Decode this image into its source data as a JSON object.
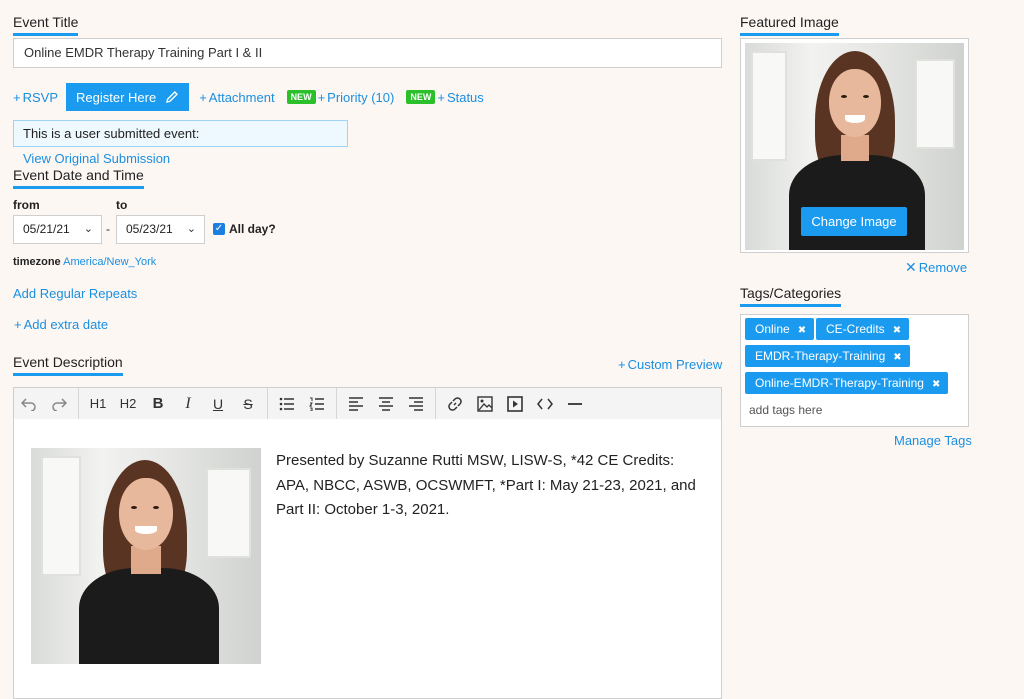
{
  "event_title": {
    "label": "Event Title",
    "value": "Online EMDR Therapy Training Part I & II"
  },
  "actions": {
    "rsvp": "RSVP",
    "register": "Register Here",
    "attachment": "Attachment",
    "new_badge": "NEW",
    "priority": "Priority (10)",
    "status": "Status"
  },
  "notice": {
    "text": "This is a user submitted event:",
    "link": "View Original Submission"
  },
  "date_time": {
    "label": "Event Date and Time",
    "from_label": "from",
    "to_label": "to",
    "from_value": "05/21/21",
    "to_value": "05/23/21",
    "dash": "-",
    "all_day": "All day?",
    "all_day_checked": true,
    "timezone_label": "timezone",
    "timezone_value": "America/New_York",
    "add_repeats": "Add Regular Repeats",
    "add_extra_date": "Add extra date"
  },
  "description": {
    "label": "Event Description",
    "custom_preview": "Custom Preview",
    "toolbar": {
      "undo": "undo-icon",
      "redo": "redo-icon",
      "h1": "H1",
      "h2": "H2",
      "bold": "B",
      "italic": "I",
      "underline": "U",
      "strike": "S"
    },
    "body_text": "Presented by Suzanne Rutti MSW, LISW-S, *42 CE Credits: APA, NBCC, ASWB, OCSWMFT, *Part I: May 21-23, 2021, and Part II: October 1-3, 2021."
  },
  "featured_image": {
    "label": "Featured Image",
    "change_button": "Change Image",
    "remove": "Remove"
  },
  "tags": {
    "label": "Tags/Categories",
    "items": [
      "Online",
      "CE-Credits",
      "EMDR-Therapy-Training",
      "Online-EMDR-Therapy-Training"
    ],
    "placeholder": "add tags here",
    "manage": "Manage Tags"
  },
  "colors": {
    "accent": "#1a9bf0",
    "new_badge": "#2cbf2c",
    "background": "#fdf7f4"
  }
}
